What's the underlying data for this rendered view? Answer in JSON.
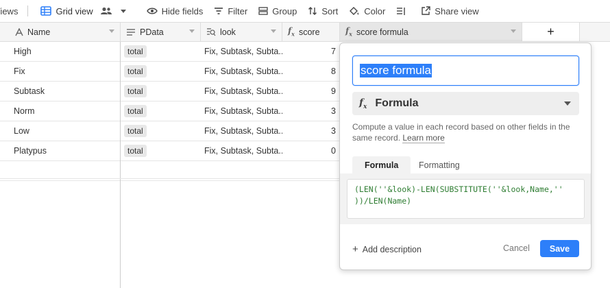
{
  "toolbar": {
    "views_label": "Views",
    "grid_view_label": "Grid view",
    "hide_fields_label": "Hide fields",
    "filter_label": "Filter",
    "group_label": "Group",
    "sort_label": "Sort",
    "color_label": "Color",
    "share_view_label": "Share view"
  },
  "columns": [
    {
      "label": "Name",
      "icon": "text-a-icon"
    },
    {
      "label": "PData",
      "icon": "link-records-icon"
    },
    {
      "label": "look",
      "icon": "lookup-icon"
    },
    {
      "label": "score",
      "icon": "formula-icon"
    },
    {
      "label": "score formula",
      "icon": "formula-icon"
    }
  ],
  "add_column_label": "+",
  "rows": [
    {
      "name": "High",
      "pdata": "total",
      "look": "Fix, Subtask, Subta...",
      "score": "7"
    },
    {
      "name": "Fix",
      "pdata": "total",
      "look": "Fix, Subtask, Subta...",
      "score": "8"
    },
    {
      "name": "Subtask",
      "pdata": "total",
      "look": "Fix, Subtask, Subta...",
      "score": "9"
    },
    {
      "name": "Norm",
      "pdata": "total",
      "look": "Fix, Subtask, Subta...",
      "score": "3"
    },
    {
      "name": "Low",
      "pdata": "total",
      "look": "Fix, Subtask, Subta...",
      "score": "3"
    },
    {
      "name": "Platypus",
      "pdata": "total",
      "look": "Fix, Subtask, Subta...",
      "score": "0"
    }
  ],
  "field_editor": {
    "field_name": "score formula",
    "field_type": "Formula",
    "description_text": "Compute a value in each record based on other fields in the same record.",
    "learn_more_label": "Learn more",
    "tab_formula": "Formula",
    "tab_formatting": "Formatting",
    "formula_line1": "(LEN(''&look)-LEN(SUBSTITUTE(''&look,Name,''",
    "formula_line2": "))/LEN(Name)",
    "add_description_label": "Add description",
    "cancel_label": "Cancel",
    "save_label": "Save"
  },
  "colors": {
    "accent": "#2d7ff9",
    "header_bg": "#f5f5f5",
    "function_green": "#2e7d32",
    "field_purple": "#7b3fb5"
  }
}
